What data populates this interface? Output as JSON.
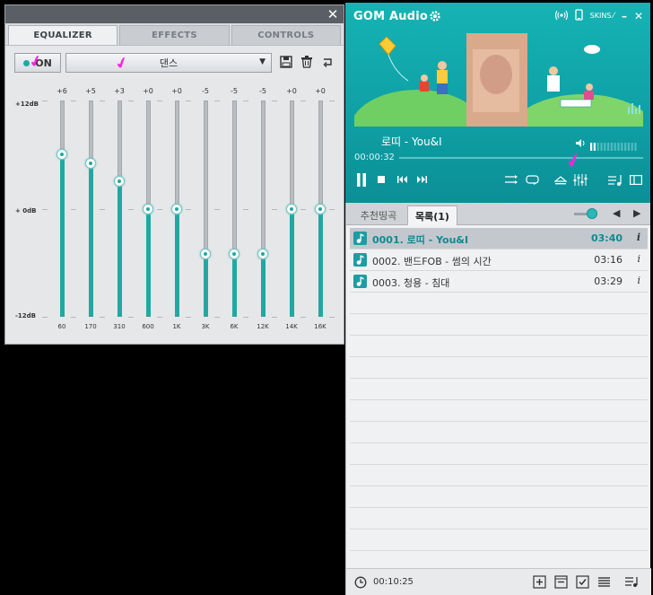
{
  "equalizer": {
    "close_glyph": "✕",
    "tabs": [
      {
        "label": "EQUALIZER",
        "active": true
      },
      {
        "label": "EFFECTS",
        "active": false
      },
      {
        "label": "CONTROLS",
        "active": false
      }
    ],
    "on_label": "ON",
    "preset": "댄스",
    "db_labels": {
      "top": "+12dB",
      "mid": "+ 0dB",
      "bottom": "-12dB"
    },
    "range_db": [
      -12,
      12
    ],
    "bands": [
      {
        "freq": "60",
        "gain_label": "+6",
        "gain": 6
      },
      {
        "freq": "170",
        "gain_label": "+5",
        "gain": 5
      },
      {
        "freq": "310",
        "gain_label": "+3",
        "gain": 3
      },
      {
        "freq": "600",
        "gain_label": "+0",
        "gain": 0
      },
      {
        "freq": "1K",
        "gain_label": "+0",
        "gain": 0
      },
      {
        "freq": "3K",
        "gain_label": "-5",
        "gain": -5
      },
      {
        "freq": "6K",
        "gain_label": "-5",
        "gain": -5
      },
      {
        "freq": "12K",
        "gain_label": "-5",
        "gain": -5
      },
      {
        "freq": "14K",
        "gain_label": "+0",
        "gain": 0
      },
      {
        "freq": "16K",
        "gain_label": "+0",
        "gain": 0
      }
    ]
  },
  "player": {
    "app_title": "GOM Audio",
    "skins_label": "SKINS",
    "track_title": "로띠  - You&I",
    "elapsed": "00:00:32",
    "progress": 0.0,
    "volume_level": 0.15
  },
  "playlist": {
    "tabs": [
      {
        "label": "추천띵곡",
        "active": false
      },
      {
        "label": "목록(1)",
        "active": true
      }
    ],
    "items": [
      {
        "title": "0001. 로띠 - You&I",
        "duration": "03:40",
        "active": true
      },
      {
        "title": "0002. 밴드FOB - 썸의 시간",
        "duration": "03:16",
        "active": false
      },
      {
        "title": "0003. 청용 - 침대",
        "duration": "03:29",
        "active": false
      }
    ],
    "info_glyph": "i",
    "total_time": "00:10:25"
  },
  "colors": {
    "accent": "#22a7a2",
    "player_bg": "#10a8ab",
    "annotation": "#ff22dd"
  }
}
